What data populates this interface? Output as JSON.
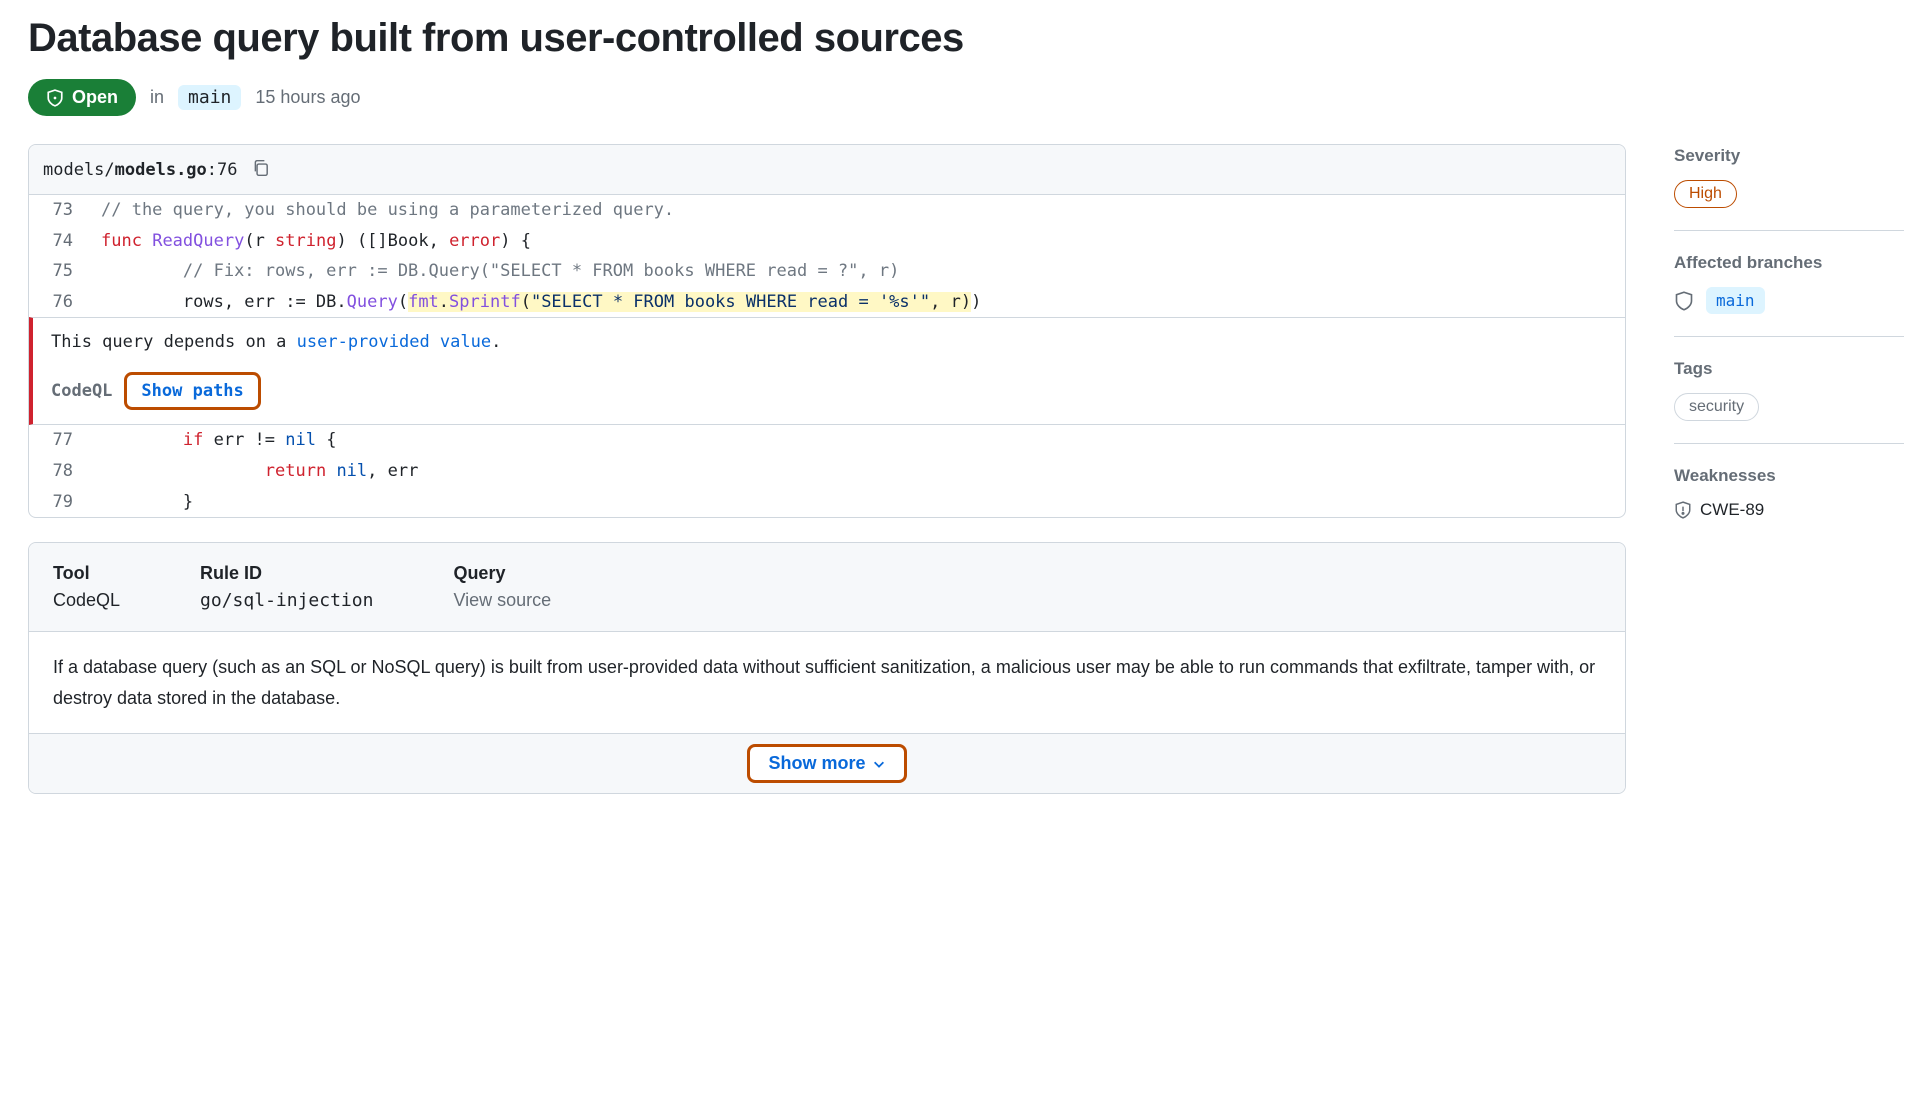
{
  "title": "Database query built from user-controlled sources",
  "status": {
    "label": "Open",
    "in_text": "in",
    "branch": "main",
    "time": "15 hours ago"
  },
  "file": {
    "path_prefix": "models/",
    "path_file": "models.go",
    "line": ":76"
  },
  "code": {
    "lines": [
      {
        "num": "73",
        "text": "// the query, you should be using a parameterized query."
      },
      {
        "num": "74",
        "text": "func ReadQuery(r string) ([]Book, error) {"
      },
      {
        "num": "75",
        "text": "        // Fix: rows, err := DB.Query(\"SELECT * FROM books WHERE read = ?\", r)"
      },
      {
        "num": "76",
        "text": "        rows, err := DB.Query(fmt.Sprintf(\"SELECT * FROM books WHERE read = '%s'\", r))"
      },
      {
        "num": "77",
        "text": "        if err != nil {"
      },
      {
        "num": "78",
        "text": "                return nil, err"
      },
      {
        "num": "79",
        "text": "        }"
      }
    ]
  },
  "alert": {
    "msg_pre": "This query depends on a ",
    "msg_link": "user-provided value",
    "msg_post": ".",
    "tool": "CodeQL",
    "show_paths": "Show paths"
  },
  "info": {
    "tool_label": "Tool",
    "tool_value": "CodeQL",
    "rule_label": "Rule ID",
    "rule_value": "go/sql-injection",
    "query_label": "Query",
    "query_value": "View source",
    "description": "If a database query (such as an SQL or NoSQL query) is built from user-provided data without sufficient sanitization, a malicious user may be able to run commands that exfiltrate, tamper with, or destroy data stored in the database.",
    "show_more": "Show more"
  },
  "sidebar": {
    "severity_label": "Severity",
    "severity_value": "High",
    "branches_label": "Affected branches",
    "branches_value": "main",
    "tags_label": "Tags",
    "tags_value": "security",
    "weaknesses_label": "Weaknesses",
    "weaknesses_value": "CWE-89"
  }
}
